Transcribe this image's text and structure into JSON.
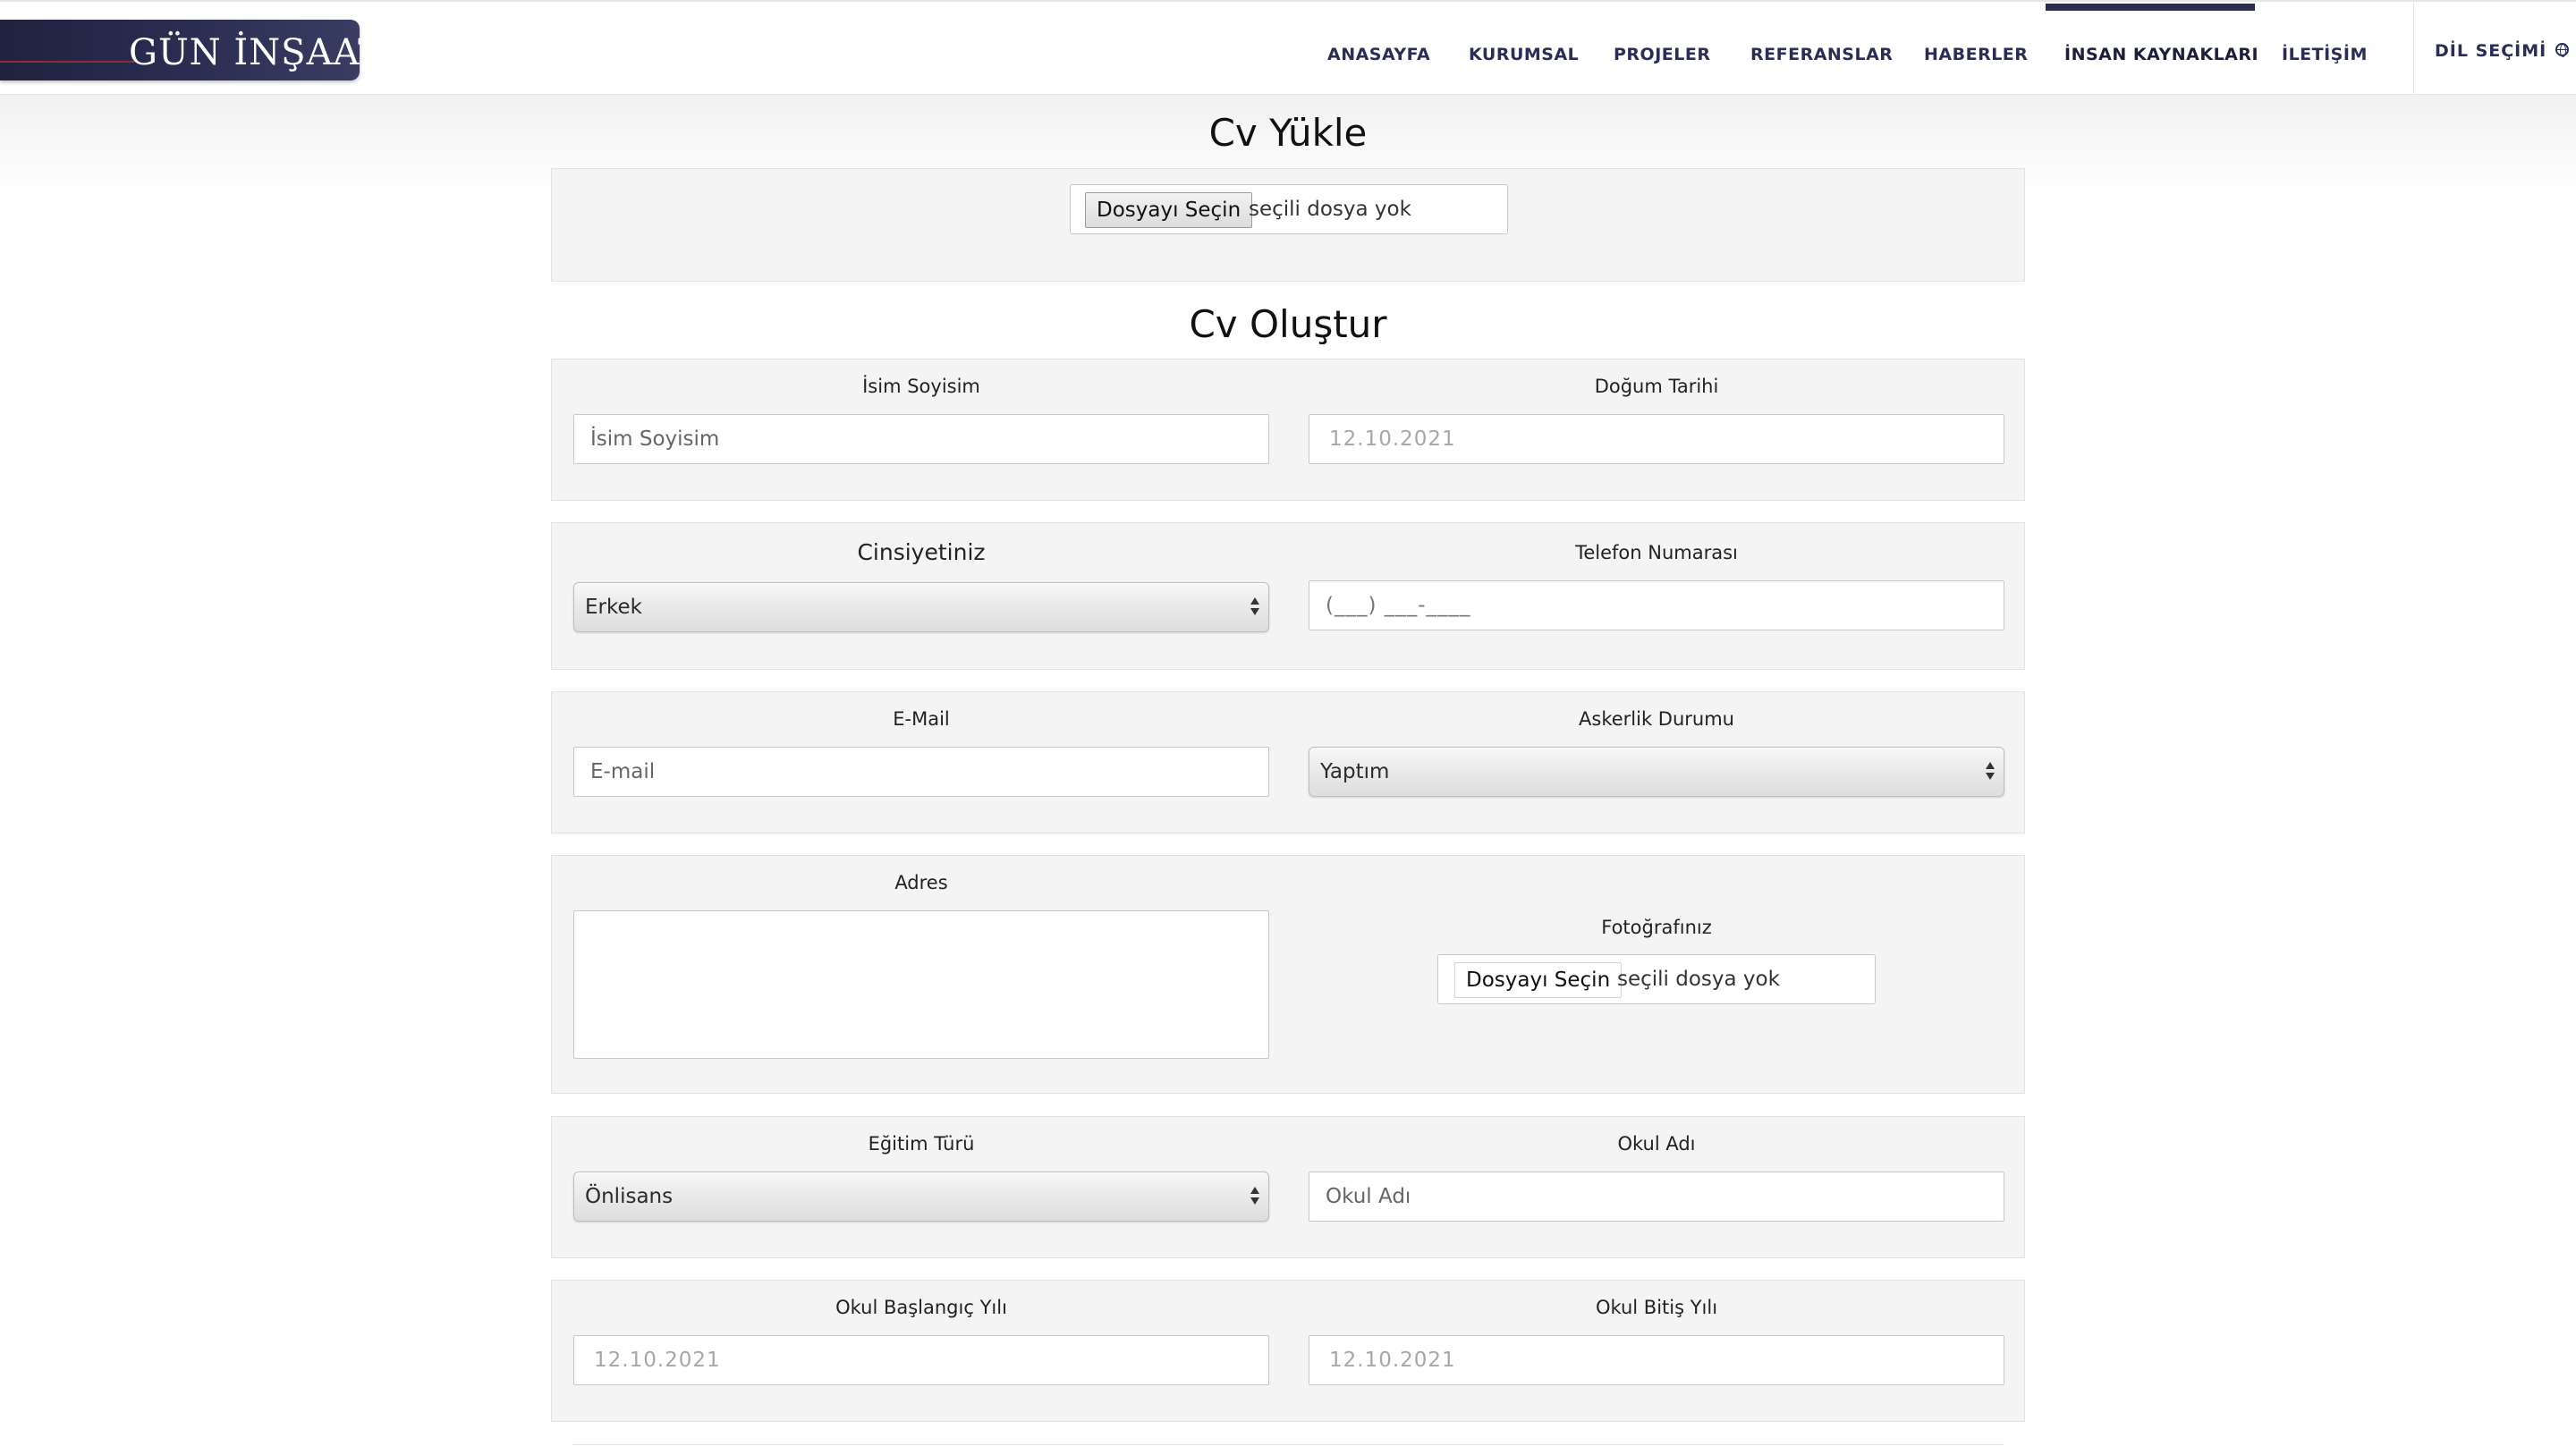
{
  "brand": {
    "name": "GÜN İNŞAAT",
    "trademark": "®"
  },
  "nav": {
    "items": [
      {
        "label": "ANASAYFA"
      },
      {
        "label": "KURUMSAL"
      },
      {
        "label": "PROJELER"
      },
      {
        "label": "REFERANSLAR"
      },
      {
        "label": "HABERLER"
      },
      {
        "label": "İNSAN KAYNAKLARI",
        "active": true
      },
      {
        "label": "İLETİŞİM"
      }
    ],
    "language_label": "DİL SEÇİMİ",
    "language_icon": "globe-icon"
  },
  "cv_upload": {
    "title": "Cv Yükle",
    "file_button": "Dosyayı Seçin",
    "file_status": "seçili dosya yok"
  },
  "cv_create": {
    "title": "Cv Oluştur",
    "name": {
      "label": "İsim Soyisim",
      "placeholder": "İsim Soyisim"
    },
    "birth_date": {
      "label": "Doğum Tarihi",
      "value": "12.10.2021"
    },
    "gender": {
      "label": "Cinsiyetiniz",
      "selected": "Erkek"
    },
    "phone": {
      "label": "Telefon Numarası",
      "value": "(___) ___-____"
    },
    "email": {
      "label": "E-Mail",
      "placeholder": "E-mail"
    },
    "military": {
      "label": "Askerlik Durumu",
      "selected": "Yaptım"
    },
    "address": {
      "label": "Adres",
      "value": ""
    },
    "photo": {
      "label": "Fotoğrafınız",
      "file_button": "Dosyayı Seçin",
      "file_status": "seçili dosya yok"
    },
    "education_type": {
      "label": "Eğitim Türü",
      "selected": "Önlisans"
    },
    "school_name": {
      "label": "Okul Adı",
      "placeholder": "Okul Adı"
    },
    "school_start": {
      "label": "Okul Başlangıç Yılı",
      "value": "12.10.2021"
    },
    "school_end": {
      "label": "Okul Bitiş Yılı",
      "value": "12.10.2021"
    }
  },
  "colors": {
    "brand_navy": "#2a2d55",
    "panel_bg": "#f4f4f4",
    "brand_accent_red": "#8a2d3c"
  }
}
